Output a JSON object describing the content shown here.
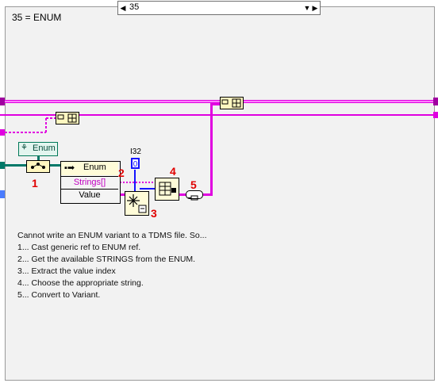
{
  "case_structure": {
    "selector_value": "35",
    "case_label": "35 = ENUM"
  },
  "nodes": {
    "class_ref_label": "Enum",
    "property_node_label": "Enum",
    "property_rows": [
      "Strings[]",
      "Value"
    ],
    "constant_type": "I32",
    "constant_value": "0"
  },
  "step_numbers": [
    "1",
    "2",
    "3",
    "4",
    "5"
  ],
  "notes": {
    "title": "Cannot write an ENUM variant to a TDMS file. So...",
    "steps": [
      "1... Cast generic ref to ENUM ref.",
      "2... Get the available STRINGS from the ENUM.",
      "3... Extract the value index",
      "4... Choose the appropriate string.",
      "5... Convert to Variant."
    ]
  },
  "colors": {
    "variant_wire": "#e000e0",
    "refnum_wire": "#007868",
    "int_wire": "#1414ff",
    "frame_border": "#202020"
  }
}
